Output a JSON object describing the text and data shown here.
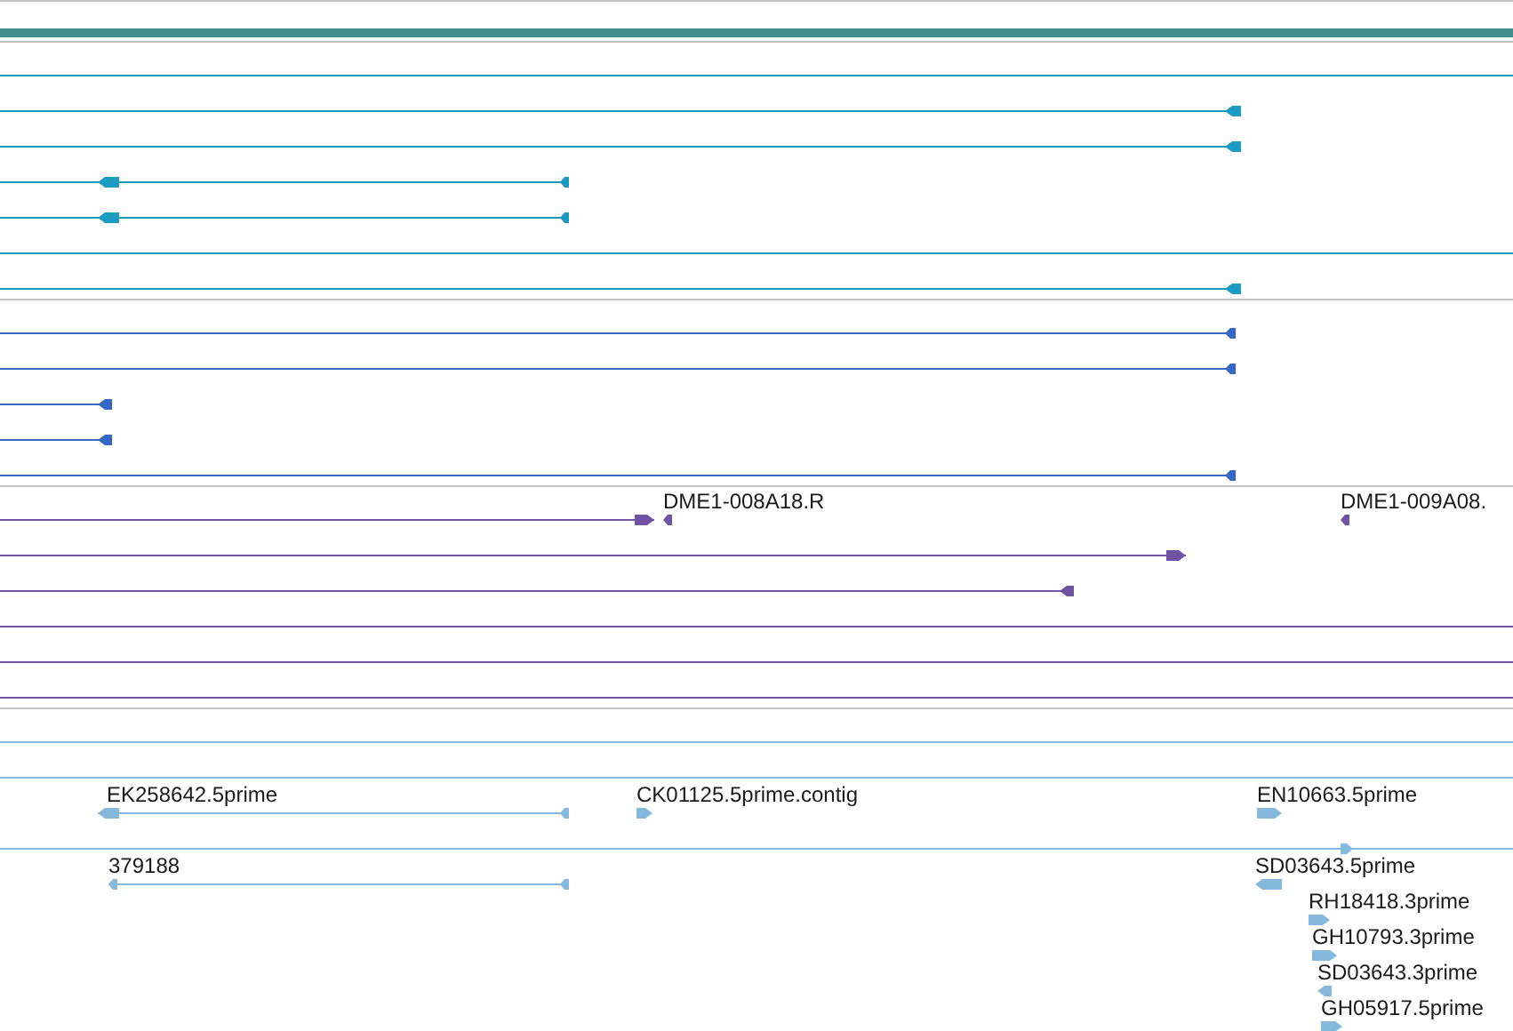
{
  "tracks": [
    {
      "color": "#1a9cc2"
    },
    {
      "color": "#3468c8"
    },
    {
      "color": "#7153a6",
      "labels": [
        "DME1-008A18.R",
        "DME1-009A08."
      ]
    },
    {
      "color": "#85b8dd",
      "labels": [
        "EK258642.5prime",
        "CK01125.5prime.contig",
        "EN10663.5prime",
        "379188",
        "SD03643.5prime",
        "RH18418.3prime",
        "GH10793.3prime",
        "SD03643.3prime",
        "GH05917.5prime"
      ]
    }
  ]
}
